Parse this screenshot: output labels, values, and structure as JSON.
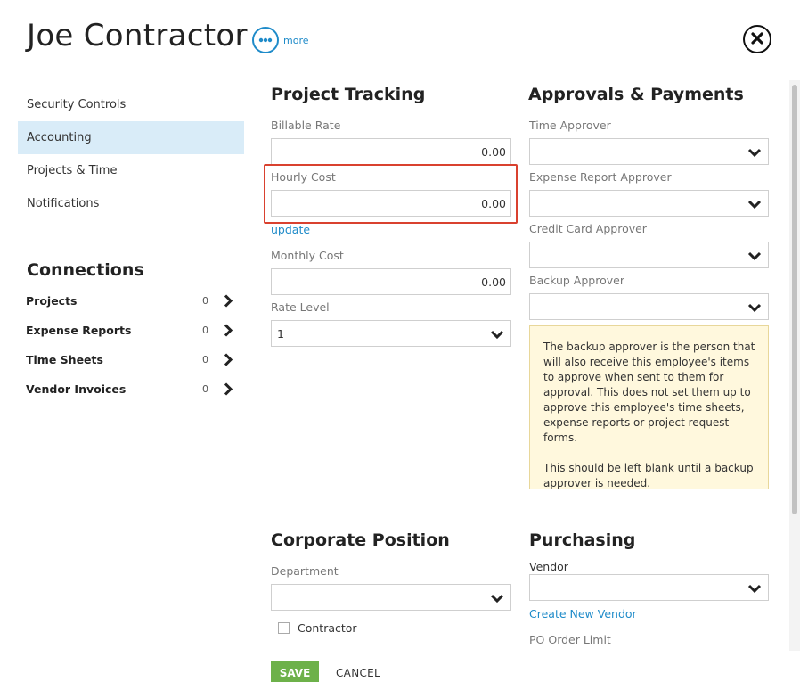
{
  "header": {
    "title": "Joe Contractor",
    "more_label": "more",
    "more_icon": "ellipsis-circle-icon",
    "close_icon": "close-circle-icon"
  },
  "sidebar": {
    "items": [
      {
        "label": "Security Controls",
        "active": false
      },
      {
        "label": "Accounting",
        "active": true
      },
      {
        "label": "Projects & Time",
        "active": false
      },
      {
        "label": "Notifications",
        "active": false
      }
    ]
  },
  "connections": {
    "title": "Connections",
    "items": [
      {
        "label": "Projects",
        "count": "0"
      },
      {
        "label": "Expense Reports",
        "count": "0"
      },
      {
        "label": "Time Sheets",
        "count": "0"
      },
      {
        "label": "Vendor Invoices",
        "count": "0"
      }
    ]
  },
  "project_tracking": {
    "title": "Project Tracking",
    "billable_rate": {
      "label": "Billable Rate",
      "value": "0.00"
    },
    "hourly_cost": {
      "label": "Hourly Cost",
      "value": "0.00"
    },
    "update_link": "update",
    "monthly_cost": {
      "label": "Monthly Cost",
      "value": "0.00"
    },
    "rate_level": {
      "label": "Rate Level",
      "value": "1"
    }
  },
  "approvals": {
    "title": "Approvals & Payments",
    "time_approver": {
      "label": "Time Approver",
      "value": ""
    },
    "expense_report_approver": {
      "label": "Expense Report Approver",
      "value": ""
    },
    "credit_card_approver": {
      "label": "Credit Card Approver",
      "value": ""
    },
    "backup_approver": {
      "label": "Backup Approver",
      "value": ""
    },
    "info_paragraph_1": "The backup approver is the person that will also receive this employee's items to approve when sent to them for approval. This does not set them up to approve this employee's time sheets, expense reports or project request forms.",
    "info_paragraph_2": "This should be left blank until a backup approver is needed."
  },
  "corporate_position": {
    "title": "Corporate Position",
    "department": {
      "label": "Department",
      "value": ""
    },
    "contractor_label": "Contractor",
    "contractor_checked": false
  },
  "purchasing": {
    "title": "Purchasing",
    "vendor": {
      "label": "Vendor",
      "value": ""
    },
    "create_vendor_link": "Create New Vendor",
    "po_order_limit_label": "PO Order Limit"
  },
  "actions": {
    "save_label": "SAVE",
    "cancel_label": "CANCEL"
  },
  "colors": {
    "accent": "#1f8bc9",
    "active_nav_bg": "#d9ecf8",
    "highlight_border": "#d9412f",
    "save_button": "#6db14a",
    "info_box_bg": "#fff8dd"
  }
}
